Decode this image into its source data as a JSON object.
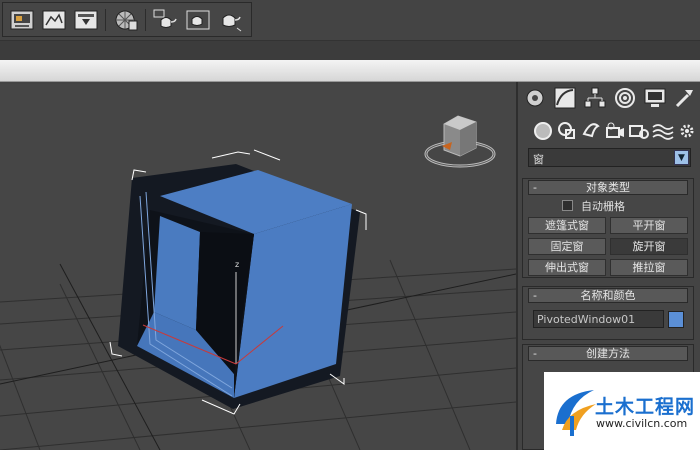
{
  "toolbar": {
    "icons": [
      "render-setup-icon",
      "rendered-frame-window-icon",
      "render-production-icon",
      "material-editor-icon",
      "teapot-render-icon",
      "teapot-iterative-icon",
      "teapot-activeshade-icon"
    ]
  },
  "command_panel": {
    "tabs": [
      "create-icon",
      "modify-icon",
      "hierarchy-icon",
      "motion-icon",
      "display-icon",
      "utilities-icon"
    ],
    "subtabs": [
      "geometry-icon",
      "shapes-icon",
      "lights-icon",
      "cameras-icon",
      "helpers-icon",
      "space-warps-icon",
      "systems-icon"
    ],
    "category_dropdown": "窗",
    "object_type": {
      "title": "对象类型",
      "autogrid_label": "自动栅格",
      "buttons": [
        "遮篷式窗",
        "平开窗",
        "固定窗",
        "旋开窗",
        "伸出式窗",
        "推拉窗"
      ],
      "active_button": "旋开窗"
    },
    "name_color": {
      "title": "名称和颜色",
      "name_value": "PivotedWindow01",
      "color": "#5b8fd6"
    },
    "creation_method": {
      "title": "创建方法"
    }
  },
  "viewport": {
    "axis_label_z": "z"
  },
  "watermark": {
    "title": "土木工程网",
    "url": "www.civilcn.com"
  }
}
